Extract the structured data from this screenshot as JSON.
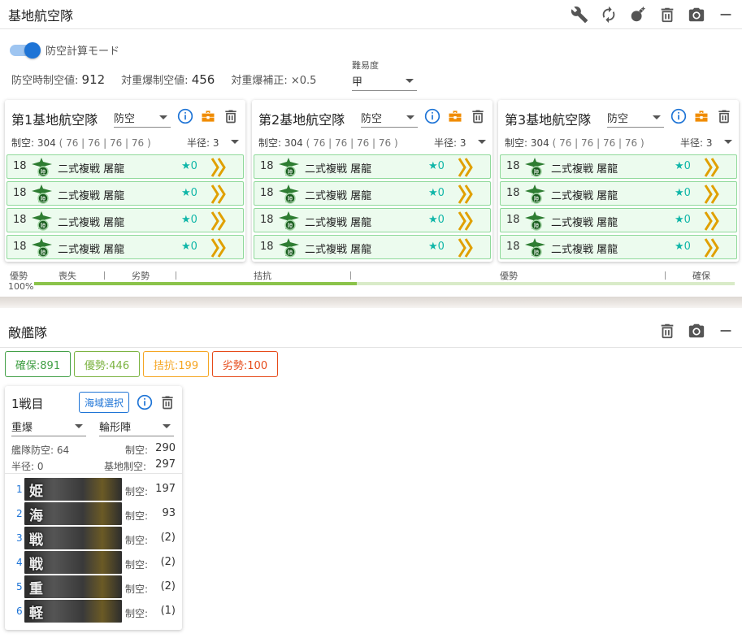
{
  "air_base": {
    "title": "基地航空隊",
    "mode_toggle_label": "防空計算モード",
    "stats": {
      "defense_label": "防空時制空値:",
      "defense_value": "912",
      "heavy_label": "対重爆制空値:",
      "heavy_value": "456",
      "correction_label": "対重爆補正:",
      "correction_value": "×0.5"
    },
    "difficulty": {
      "label": "難易度",
      "value": "甲"
    },
    "bases": [
      {
        "name": "第1基地航空隊",
        "mode": "防空",
        "air_power": "制空: 304",
        "detail": "( 76 | 76 | 76 | 76 )",
        "radius": "半径: 3"
      },
      {
        "name": "第2基地航空隊",
        "mode": "防空",
        "air_power": "制空: 304",
        "detail": "( 76 | 76 | 76 | 76 )",
        "radius": "半径: 3"
      },
      {
        "name": "第3基地航空隊",
        "mode": "防空",
        "air_power": "制空: 304",
        "detail": "( 76 | 76 | 76 | 76 )",
        "radius": "半径: 3"
      }
    ],
    "plane": {
      "count": "18",
      "name": "二式複戦 屠龍",
      "improvement": "★0"
    },
    "gauge": {
      "status_label": "優勢",
      "percent": "100%",
      "zones": [
        "喪失",
        "劣勢",
        "拮抗",
        "優勢",
        "確保"
      ],
      "fill_fraction": 0.46
    }
  },
  "enemy": {
    "title": "敵艦隊",
    "chips": [
      {
        "label": "確保:891",
        "color": "#43a047"
      },
      {
        "label": "優勢:446",
        "color": "#7cb342"
      },
      {
        "label": "拮抗:199",
        "color": "#f5a623"
      },
      {
        "label": "劣勢:100",
        "color": "#e64a19"
      }
    ],
    "fleet": {
      "name": "1戦目",
      "area_button": "海域選択",
      "formation_type": "重爆",
      "formation": "輪形陣",
      "fleet_aa_label": "艦隊防空: 64",
      "air_label": "制空:",
      "air_value": "290",
      "radius_label": "半径: 0",
      "base_air_label": "基地制空:",
      "base_air_value": "297",
      "ships": [
        {
          "index": "1",
          "glyph": "姫",
          "label": "制空:",
          "value": "197"
        },
        {
          "index": "2",
          "glyph": "海",
          "label": "制空:",
          "value": "93"
        },
        {
          "index": "3",
          "glyph": "戦",
          "label": "制空:",
          "value": "(2)"
        },
        {
          "index": "4",
          "glyph": "戦",
          "label": "制空:",
          "value": "(2)"
        },
        {
          "index": "5",
          "glyph": "重",
          "label": "制空:",
          "value": "(2)"
        },
        {
          "index": "6",
          "glyph": "軽",
          "label": "制空:",
          "value": "(1)"
        }
      ]
    }
  },
  "colors": {
    "accent": "#1e74d6",
    "slot_border": "#8fd99a",
    "slot_bg": "#ecfbee",
    "star": "#10b6a8",
    "proficiency": "#e0a000",
    "toolbox": "#f08c00"
  },
  "icons": [
    "wrench-icon",
    "refresh-icon",
    "bomb-icon",
    "trash-icon",
    "camera-icon",
    "minimize-icon",
    "info-icon",
    "toolbox-icon",
    "plane-icon",
    "proficiency-icon"
  ]
}
